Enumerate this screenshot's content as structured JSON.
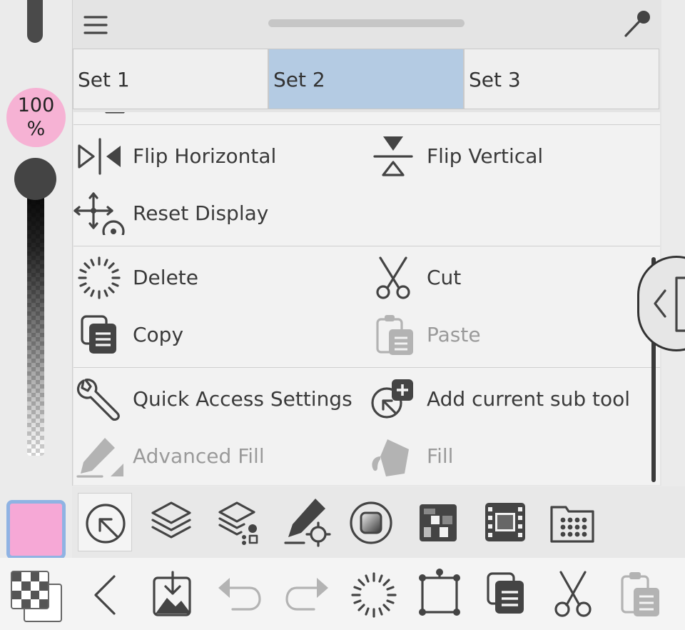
{
  "opacity": {
    "value": "100",
    "unit": "%"
  },
  "tabs": [
    {
      "label": "Set 1",
      "active": false
    },
    {
      "label": "Set 2",
      "active": true
    },
    {
      "label": "Set 3",
      "active": false
    }
  ],
  "menu": {
    "flip_horizontal": "Flip Horizontal",
    "flip_vertical": "Flip Vertical",
    "reset_display": "Reset Display",
    "delete": "Delete",
    "cut": "Cut",
    "copy": "Copy",
    "paste": "Paste",
    "quick_access_settings": "Quick Access Settings",
    "add_current_sub_tool": "Add current sub tool",
    "advanced_fill": "Advanced Fill",
    "fill": "Fill"
  },
  "colors": {
    "main_color": "#f6a8d6",
    "active_tab": "#b4cbe3",
    "opacity_badge": "#f6b2d4"
  },
  "palette_icons": [
    "quick-access-icon",
    "layers-icon",
    "layer-property-icon",
    "tool-property-icon",
    "color-circle-icon",
    "color-set-icon",
    "timeline-icon",
    "material-icon"
  ],
  "bottom_icons": [
    "transparent-color-icon",
    "back-icon",
    "import-icon",
    "undo-icon",
    "redo-icon",
    "delete-icon",
    "transform-icon",
    "copy-icon",
    "cut-icon",
    "paste-icon"
  ]
}
